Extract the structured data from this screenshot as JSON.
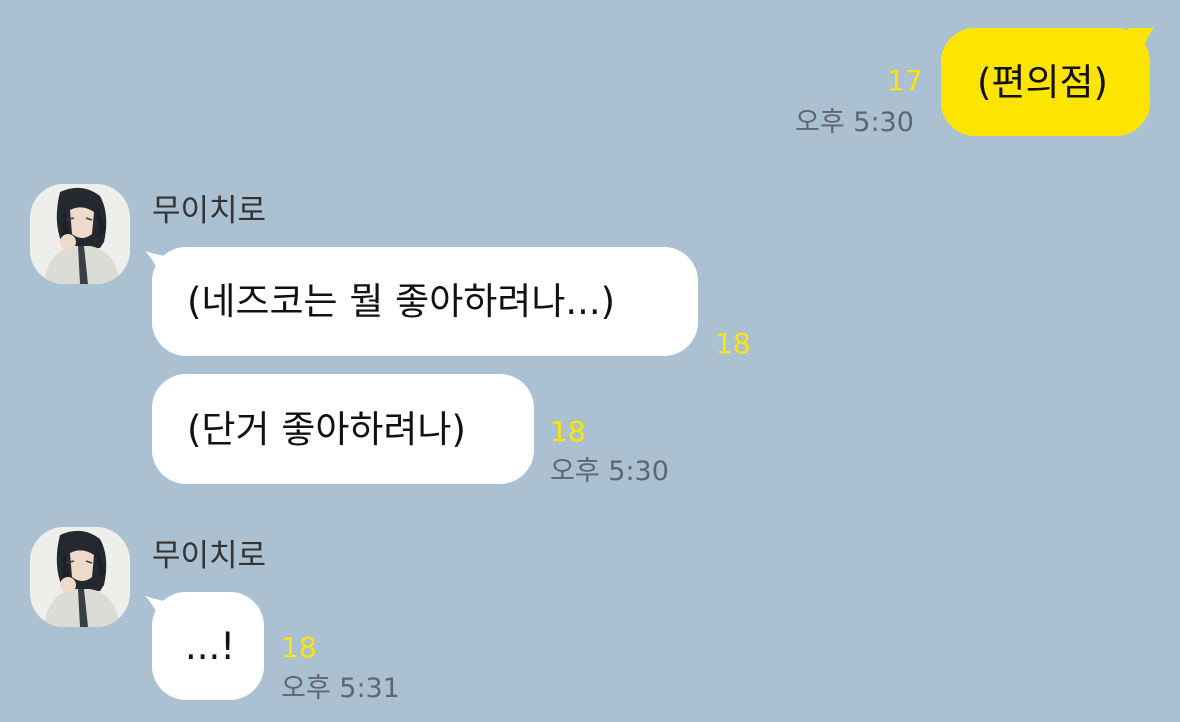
{
  "chat": {
    "outgoing": {
      "text": "(편의점)",
      "unread": "17",
      "time": "오후 5:30"
    },
    "group1": {
      "sender": "무이치로",
      "msg1": {
        "text": "(네즈코는 뭘 좋아하려나...)",
        "unread": "18"
      },
      "msg2": {
        "text": "(단거 좋아하려나)",
        "unread": "18",
        "time": "오후 5:30"
      }
    },
    "group2": {
      "sender": "무이치로",
      "msg1": {
        "text": "...!",
        "unread": "18",
        "time": "오후 5:31"
      }
    }
  },
  "colors": {
    "background": "#abc1d1",
    "outgoing_bubble": "#fee500",
    "incoming_bubble": "#ffffff",
    "unread_count": "#fee500",
    "time_text": "#5e6670"
  },
  "icons": {
    "avatar": "profile-avatar-icon"
  }
}
